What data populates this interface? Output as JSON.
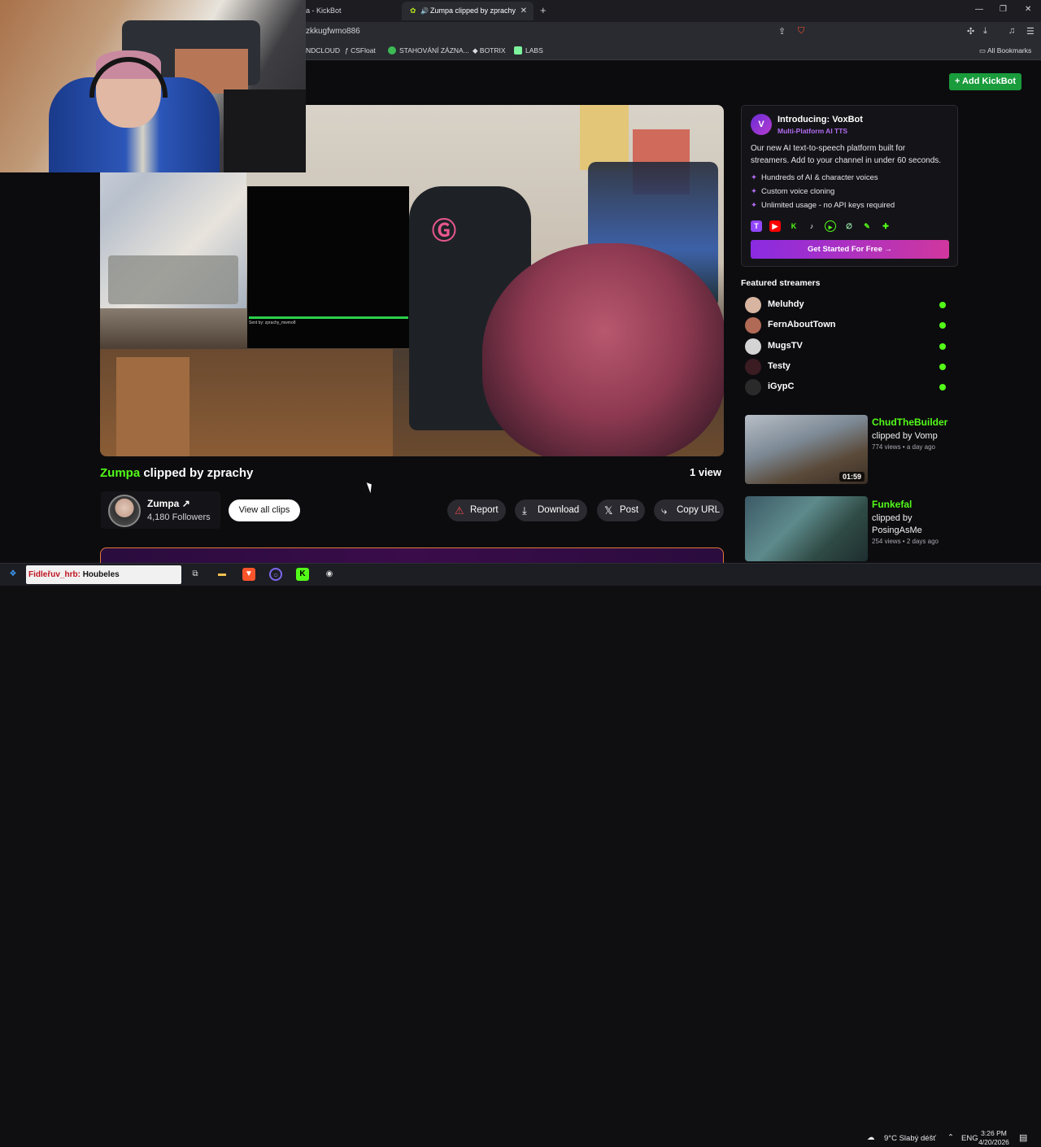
{
  "browser": {
    "tabs": [
      {
        "label": "a - KickBot",
        "active": false
      },
      {
        "label": "Zumpa clipped by zprachy",
        "active": true
      }
    ],
    "url": "zkkugfwmo886",
    "bookmarks": [
      {
        "label": "NDCLOUD",
        "color": "#ff5500"
      },
      {
        "label": "CSFloat",
        "color": "#ffffff"
      },
      {
        "label": "STAHOVÁNÍ ZÁZNA...",
        "color": "#3cba54"
      },
      {
        "label": "BOTRIX",
        "color": "#dddddd"
      },
      {
        "label": "LABS",
        "color": "#7cf29c"
      }
    ],
    "all_bookmarks": "All Bookmarks"
  },
  "header": {
    "add_kickbot": "+ Add KickBot"
  },
  "clip": {
    "streamer": "Zumpa",
    "title_rest": " clipped by zprachy",
    "views": "1 view",
    "overlay_sent": "Sent by: zprachy_mwmo8",
    "channel_name": "Zumpa",
    "followers": "4,180 Followers",
    "view_all": "View all clips"
  },
  "actions": {
    "report": "Report",
    "download": "Download",
    "post": "Post",
    "copy_url": "Copy URL"
  },
  "promo": {
    "logo": "V",
    "title": "Introducing: VoxBot",
    "subtitle": "Multi-Platform AI TTS",
    "description": "Our new AI text-to-speech platform built for streamers. Add to your channel in under 60 seconds.",
    "features": [
      "Hundreds of AI & character voices",
      "Custom voice cloning",
      "Unlimited usage - no API keys required"
    ],
    "cta": "Get Started For Free →"
  },
  "featured": {
    "heading": "Featured streamers",
    "streamers": [
      "Meluhdy",
      "FernAboutTown",
      "MugsTV",
      "Testy",
      "iGypC"
    ]
  },
  "related_clips": [
    {
      "streamer": "ChudTheBuilder",
      "by": "clipped by Vomp",
      "meta": "774 views • a day ago",
      "duration": "01:59"
    },
    {
      "streamer": "Funkefal",
      "by": "clipped by PosingAsMe",
      "meta": "254 views • 2 days ago",
      "duration": ""
    }
  ],
  "taskbar": {
    "search_red": "Fidleřuv_hrb:",
    "search_black": "Houbeles",
    "weather": "9°C  Slabý déšť",
    "lang": "ENG",
    "time": "3:26 PM",
    "date": "4/20/2026"
  }
}
